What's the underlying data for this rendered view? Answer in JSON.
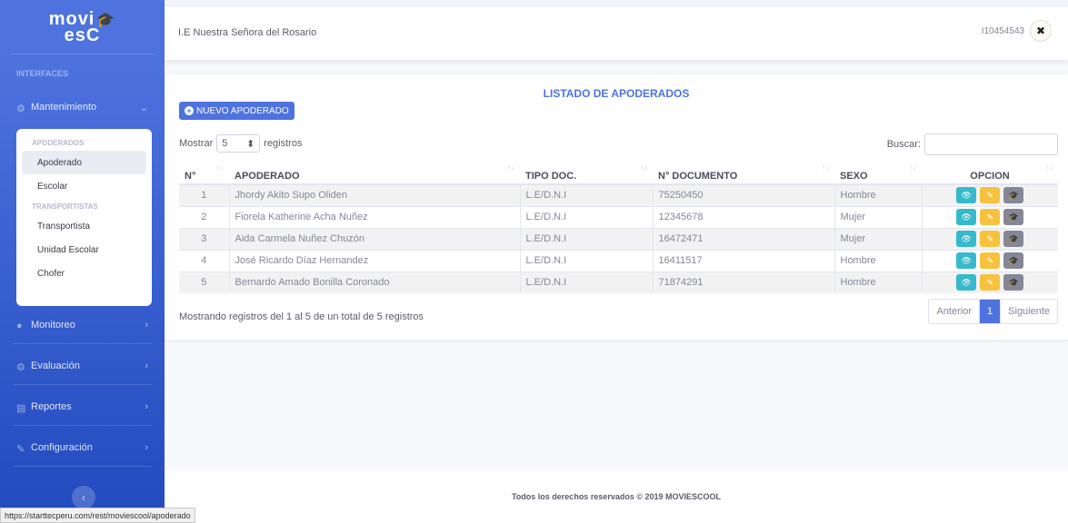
{
  "brand": {
    "line1": "movi",
    "line2": "esC",
    "logo_icon": "graduation-cap-icon"
  },
  "sidebar": {
    "heading": "INTERFACES",
    "items": [
      {
        "label": "Mantenimiento",
        "icon": "gear-icon",
        "chevron": "chevron-down-icon"
      },
      {
        "label": "Monitoreo",
        "icon": "map-marker-icon",
        "chevron": "chevron-right-icon"
      },
      {
        "label": "Evaluación",
        "icon": "gear-icon",
        "chevron": "chevron-right-icon"
      },
      {
        "label": "Reportes",
        "icon": "file-icon",
        "chevron": "chevron-right-icon"
      },
      {
        "label": "Configuración",
        "icon": "wrench-icon",
        "chevron": "chevron-right-icon"
      }
    ],
    "submenu": {
      "header1": "APODERADOS",
      "items1": [
        "Apoderado",
        "Escolar"
      ],
      "header2": "TRANSPORTISTAS",
      "items2": [
        "Transportista",
        "Unidad Escolar",
        "Chofer"
      ]
    },
    "toggle": "‹"
  },
  "topbar": {
    "school": "I.E Nuestra Señora del Rosario",
    "user": "I10454543"
  },
  "card": {
    "title": "LISTADO DE APODERADOS",
    "new_button": "NUEVO APODERADO",
    "length_prefix": "Mostrar",
    "length_value": "5",
    "length_suffix": "registros",
    "search_label": "Buscar:",
    "search_value": ""
  },
  "table": {
    "headers": [
      "N°",
      "APODERADO",
      "TIPO DOC.",
      "N° DOCUMENTO",
      "SEXO",
      "OPCION"
    ],
    "rows": [
      [
        "1",
        "Jhordy Akito Supo Oliden",
        "L.E/D.N.I",
        "75250450",
        "Hombre"
      ],
      [
        "2",
        "Fiorela Katherine Acha Nuñez",
        "L.E/D.N.I",
        "12345678",
        "Mujer"
      ],
      [
        "3",
        "Aida Carmela Nuñez Chuzón",
        "L.E/D.N.I",
        "16472471",
        "Mujer"
      ],
      [
        "4",
        "José Ricardo Díaz Hernandez",
        "L.E/D.N.I",
        "16411517",
        "Hombre"
      ],
      [
        "5",
        "Bernardo Amado Bonilla Coronado",
        "L.E/D.N.I",
        "71874291",
        "Hombre"
      ]
    ]
  },
  "info": "Mostrando registros del 1 al 5 de un total de 5 registros",
  "pager": {
    "prev": "Anterior",
    "page": "1",
    "next": "Siguiente"
  },
  "footer": "Todos los derechos reservados © 2019 MOVIESCOOL",
  "status_url": "https://starttecperu.com/rest/moviescool/apoderado",
  "colors": {
    "primary": "#4e73df",
    "info": "#36b9cc",
    "warning": "#f6c23e",
    "secondary": "#858796"
  }
}
